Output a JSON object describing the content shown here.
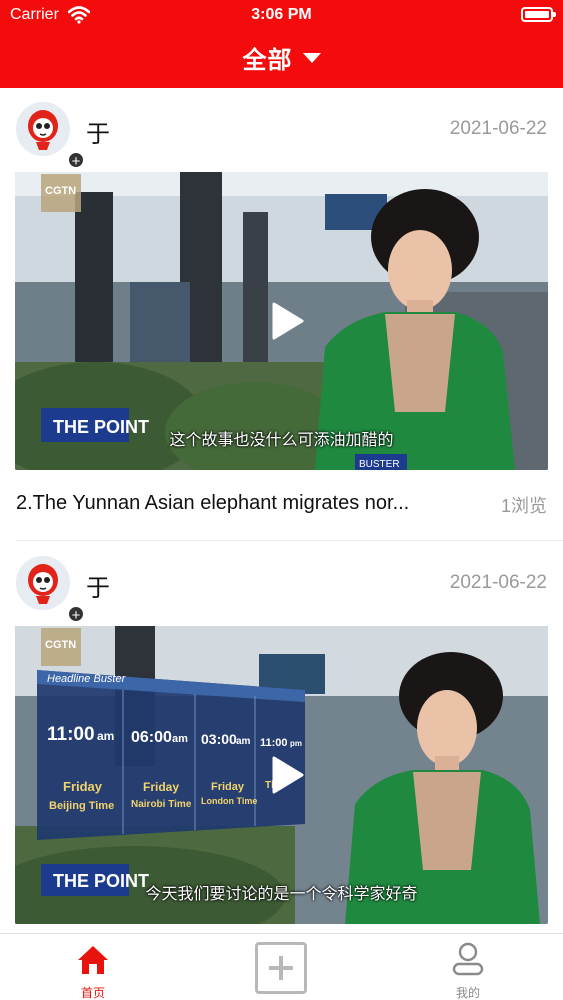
{
  "status_bar": {
    "carrier": "Carrier",
    "time": "3:06 PM"
  },
  "header": {
    "title": "全部",
    "accent_color": "#f40b0b"
  },
  "feed": {
    "posts": [
      {
        "author": "于",
        "date": "2021-06-22",
        "video": {
          "channel_logo": "CGTN",
          "show_logo": "THE POINT",
          "subtitle": "这个故事也没什么可添油加醋的",
          "lower_tag": "BUSTER"
        },
        "caption": "2.The Yunnan Asian elephant migrates nor...",
        "views": "1浏览"
      },
      {
        "author": "于",
        "date": "2021-06-22",
        "video": {
          "channel_logo": "CGTN",
          "show_logo": "THE POINT",
          "subtitle": "今天我们要讨论的是一个令科学家好奇",
          "panel_title": "Headline Buster",
          "clocks": [
            {
              "time": "11:00",
              "suffix": "am",
              "day": "Friday",
              "city": "Beijing Time"
            },
            {
              "time": "06:00",
              "suffix": "am",
              "day": "Friday",
              "city": "Nairobi Time"
            },
            {
              "time": "03:00",
              "suffix": "am",
              "day": "Friday",
              "city": "London Time"
            },
            {
              "time": "11:00",
              "suffix": "pm",
              "day": "Th",
              "city": ""
            }
          ]
        }
      }
    ]
  },
  "tabbar": {
    "home_label": "首页",
    "mine_label": "我的",
    "active_color": "#e8130d"
  }
}
